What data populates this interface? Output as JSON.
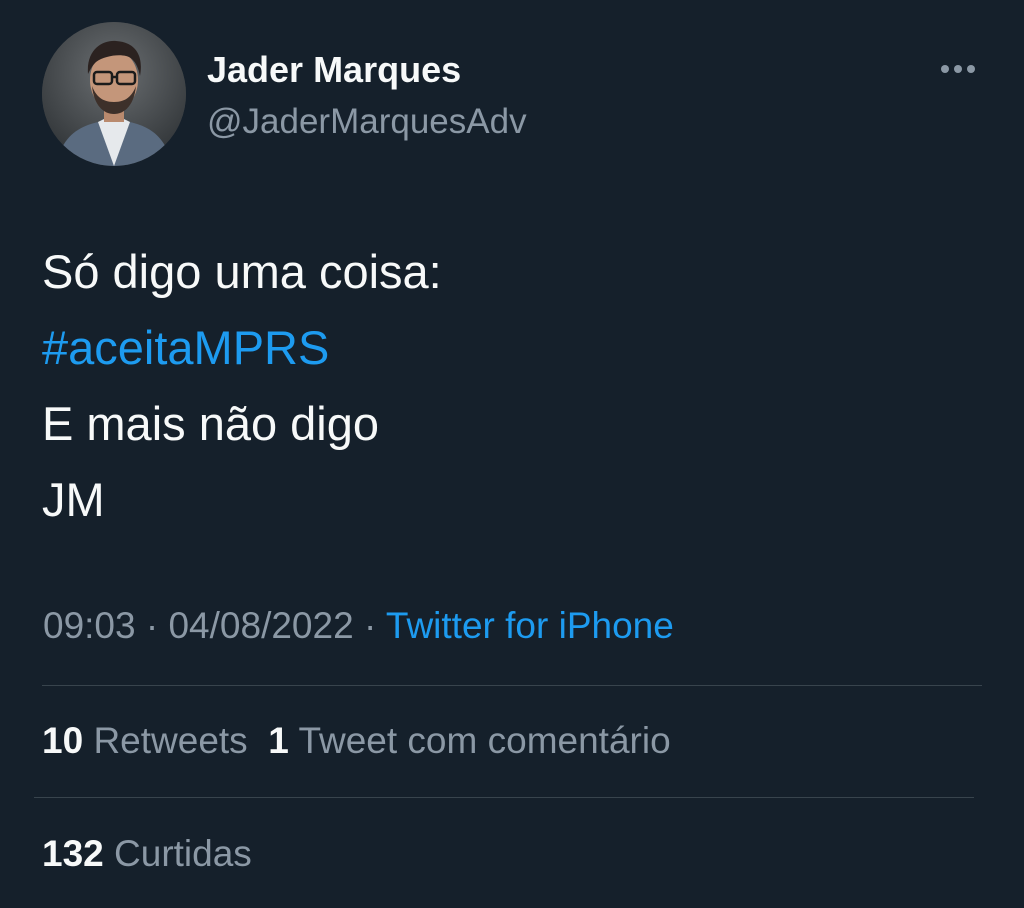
{
  "author": {
    "name": "Jader Marques",
    "handle": "@JaderMarquesAdv"
  },
  "tweet": {
    "line1": "Só digo uma coisa:",
    "hashtag": "#aceitaMPRS",
    "line3": "E mais não digo",
    "line4": "JM"
  },
  "meta": {
    "time": "09:03",
    "separator": "·",
    "date": "04/08/2022",
    "source": "Twitter for iPhone"
  },
  "stats": {
    "retweets_count": "10",
    "retweets_label": "Retweets",
    "quotes_count": "1",
    "quotes_label": "Tweet com comentário",
    "likes_count": "132",
    "likes_label": "Curtidas"
  },
  "icons": {
    "more": "more-options-icon"
  },
  "colors": {
    "background": "#15202b",
    "text": "#f7f9f9",
    "secondary": "#8b98a5",
    "accent": "#1d9bf0",
    "divider": "#38444d"
  }
}
